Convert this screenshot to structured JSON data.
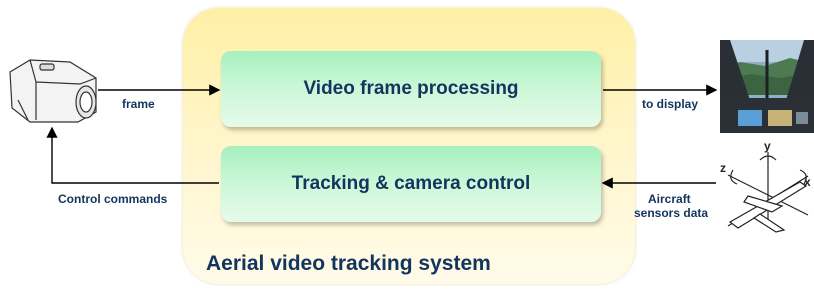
{
  "system": {
    "label": "Aerial video tracking system"
  },
  "blocks": {
    "video": "Video frame processing",
    "tracking": "Tracking & camera control"
  },
  "labels": {
    "frame": "frame",
    "to_display": "to  display",
    "control_commands": "Control commands",
    "aircraft_line1": "Aircraft",
    "aircraft_line2": "sensors data"
  },
  "axes": {
    "y": "y",
    "z": "z",
    "x": "x"
  },
  "colors": {
    "text": "#13345f",
    "system_fill": "#fff0a6",
    "block_fill": "#a6f0bd",
    "arrow": "#000000"
  }
}
